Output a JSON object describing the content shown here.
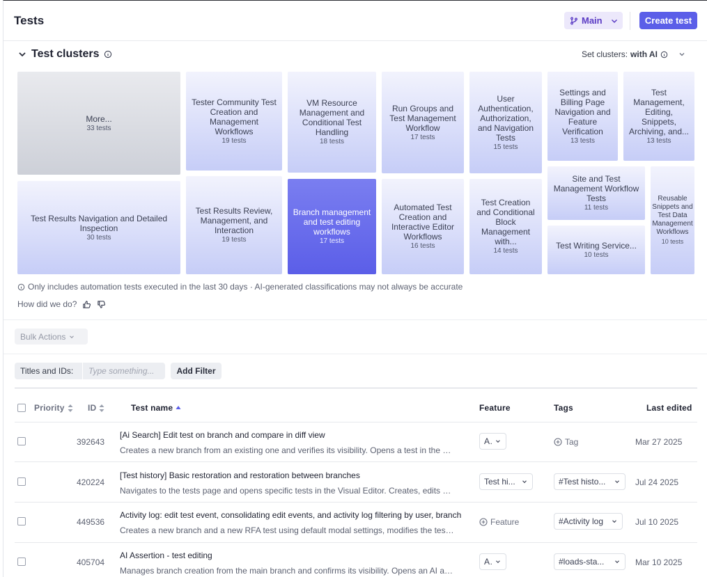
{
  "header": {
    "title": "Tests",
    "branch_label": "Main",
    "create_label": "Create test"
  },
  "clusters": {
    "title": "Test clusters",
    "set_label": "Set clusters:",
    "set_value": "with AI",
    "tiles": [
      {
        "name": "More...",
        "count": "33 tests"
      },
      {
        "name": "Tester Community Test Creation and Management Workflows",
        "count": "19 tests"
      },
      {
        "name": "VM Resource Management and Conditional Test Handling",
        "count": "18 tests"
      },
      {
        "name": "Run Groups and Test Management Workflow",
        "count": "17 tests"
      },
      {
        "name": "User Authentication, Authorization, and Navigation Tests",
        "count": "15 tests"
      },
      {
        "name": "Settings and Billing Page Navigation and Feature Verification",
        "count": "13 tests"
      },
      {
        "name": "Test Management, Editing, Snippets, Archiving, and...",
        "count": "13 tests"
      },
      {
        "name": "Test Results Navigation and Detailed Inspection",
        "count": "30 tests"
      },
      {
        "name": "Test Results Review, Management, and Interaction",
        "count": "19 tests"
      },
      {
        "name": "Branch management and test editing workflows",
        "count": "17 tests"
      },
      {
        "name": "Automated Test Creation and Interactive Editor Workflows",
        "count": "16 tests"
      },
      {
        "name": "Test Creation and Conditional Block Management with...",
        "count": "14 tests"
      },
      {
        "name": "Site and Test Management Workflow Tests",
        "count": "11 tests"
      },
      {
        "name": "Test Writing Service...",
        "count": "10 tests"
      },
      {
        "name": "Reusable Snippets and Test Data Management Workflows",
        "count": "10 tests"
      }
    ],
    "disclaimer": "Only includes automation tests executed in the last 30 days · AI-generated classifications may not always be accurate",
    "feedback_label": "How did we do?"
  },
  "toolbar": {
    "bulk_label": "Bulk Actions",
    "filter_label": "Titles and IDs:",
    "filter_placeholder": "Type something...",
    "add_filter_label": "Add Filter"
  },
  "table": {
    "columns": {
      "priority": "Priority",
      "id": "ID",
      "name": "Test name",
      "feature": "Feature",
      "tags": "Tags",
      "edited": "Last edited"
    },
    "rows": [
      {
        "id": "392643",
        "title": "[Ai Search] Edit test on branch and compare in diff view",
        "desc": "Creates a new branch from an existing one and verifies its visibility. Opens a test in the Visual Editor",
        "feature": "AI",
        "tag": "Tag",
        "date": "Mar 27 2025"
      },
      {
        "id": "420224",
        "title": "[Test history] Basic restoration and restoration between branches",
        "desc": "Navigates to the tests page and opens specific tests in the Visual Editor. Creates, edits and restores",
        "feature": "Test hi...",
        "tag": "#Test histo...",
        "date": "Jul 24 2025"
      },
      {
        "id": "449536",
        "title": "Activity log: edit test event, consolidating edit events, and activity log filtering by user, branch",
        "desc": "Creates a new branch and a new RFA test using default modal settings, modifies the test and checks logs",
        "feature": "Feature",
        "tag": "#Activity log",
        "date": "Jul 10 2025"
      },
      {
        "id": "405704",
        "title": "AI Assertion - test editing",
        "desc": "Manages branch creation from the main branch and confirms its visibility. Opens an AI assertion test",
        "feature": "AI",
        "tag": "#loads-sta...",
        "date": "Mar 10 2025"
      }
    ]
  }
}
